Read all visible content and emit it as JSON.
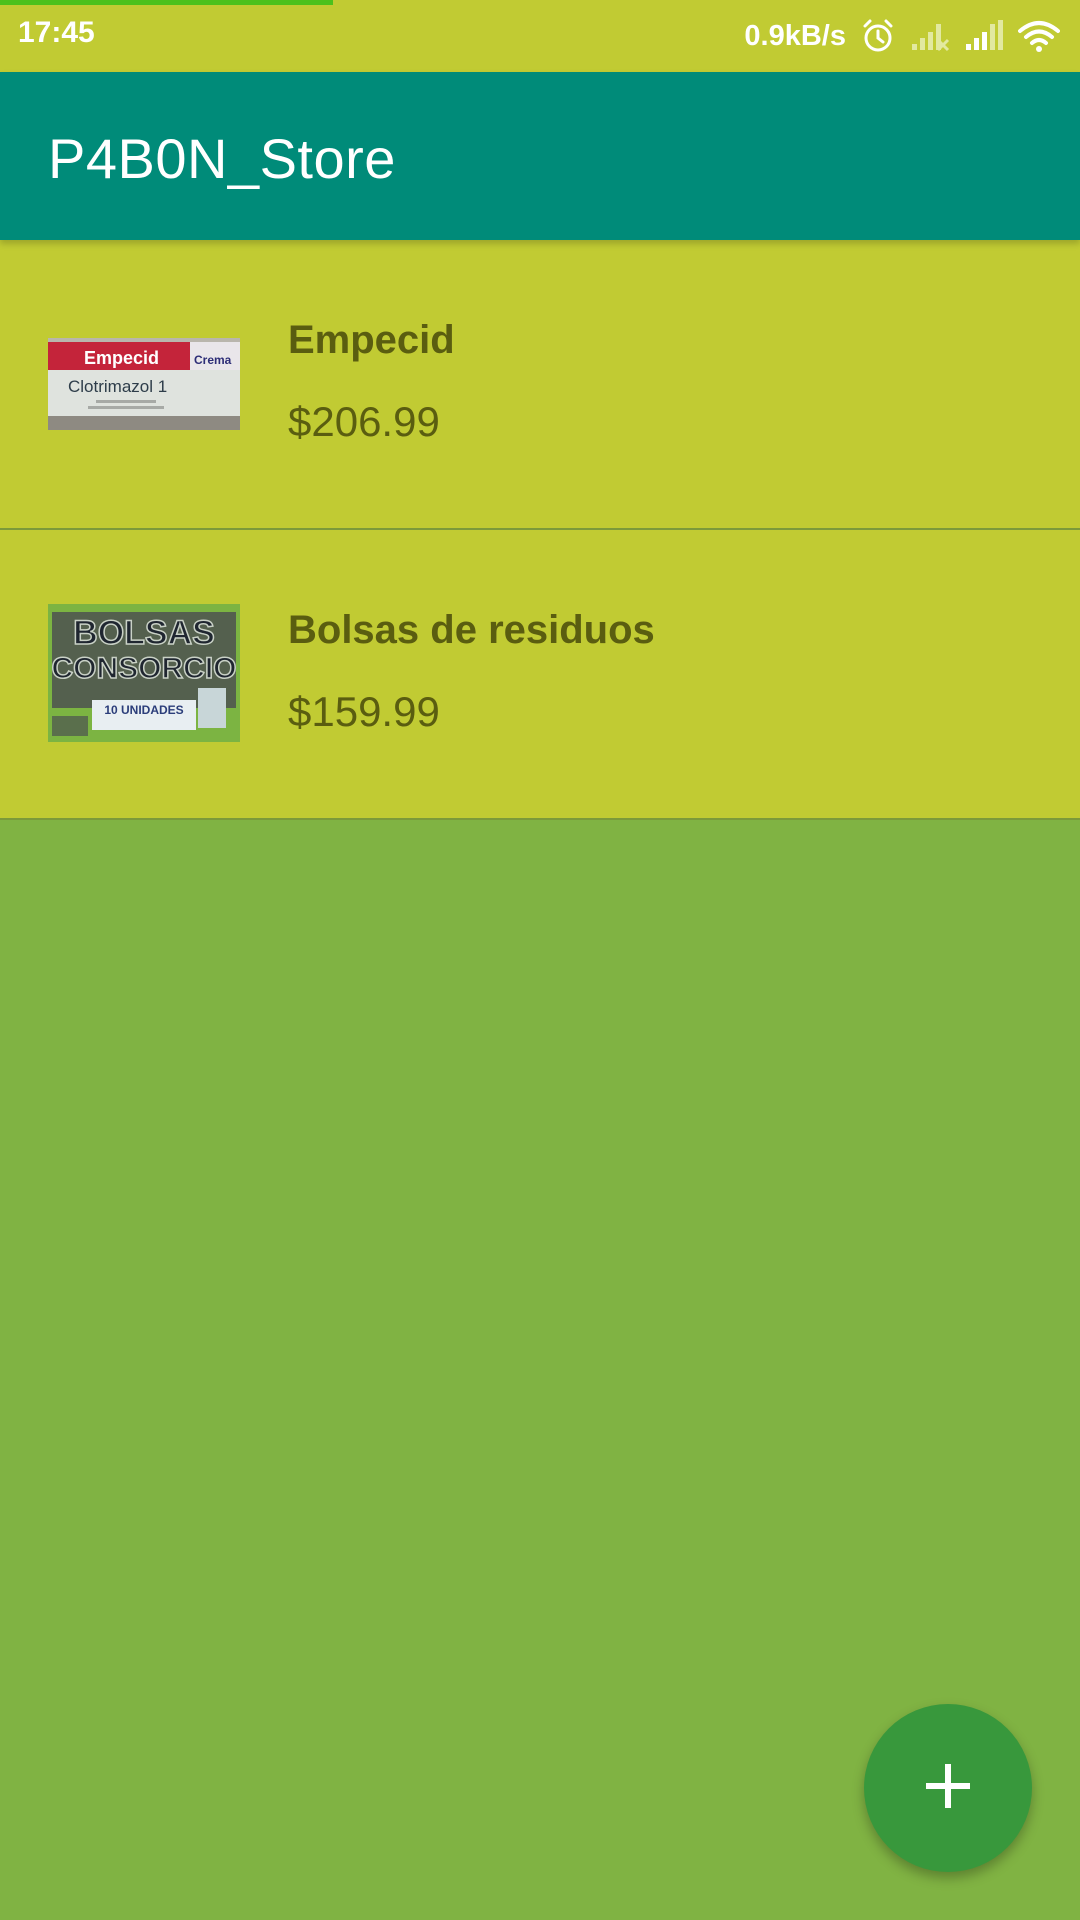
{
  "status_bar": {
    "time": "17:45",
    "network_speed": "0.9kB/s",
    "icons": [
      "alarm-icon",
      "signal-no-sim-icon",
      "signal-icon",
      "wifi-icon"
    ]
  },
  "app_bar": {
    "title": "P4B0N_Store"
  },
  "products": [
    {
      "name": "Empecid",
      "price": "$206.99",
      "thumbnail": {
        "icon": "product-photo-icon",
        "brand": "Empecid",
        "tag": "Crema",
        "subtitle": "Clotrimazol 1"
      }
    },
    {
      "name": "Bolsas de residuos",
      "price": "$159.99",
      "thumbnail": {
        "icon": "product-photo-icon",
        "line1": "BOLSAS",
        "line2": "CONSORCIO",
        "line3": "10 UNIDADES"
      }
    }
  ],
  "fab": {
    "icon": "plus-icon"
  },
  "colors": {
    "status_bar": "#c1cb33",
    "app_bar": "#008b79",
    "list_item": "#c1cb33",
    "background": "#80b343",
    "fab": "#38983c",
    "item_text": "#5a5d10"
  }
}
